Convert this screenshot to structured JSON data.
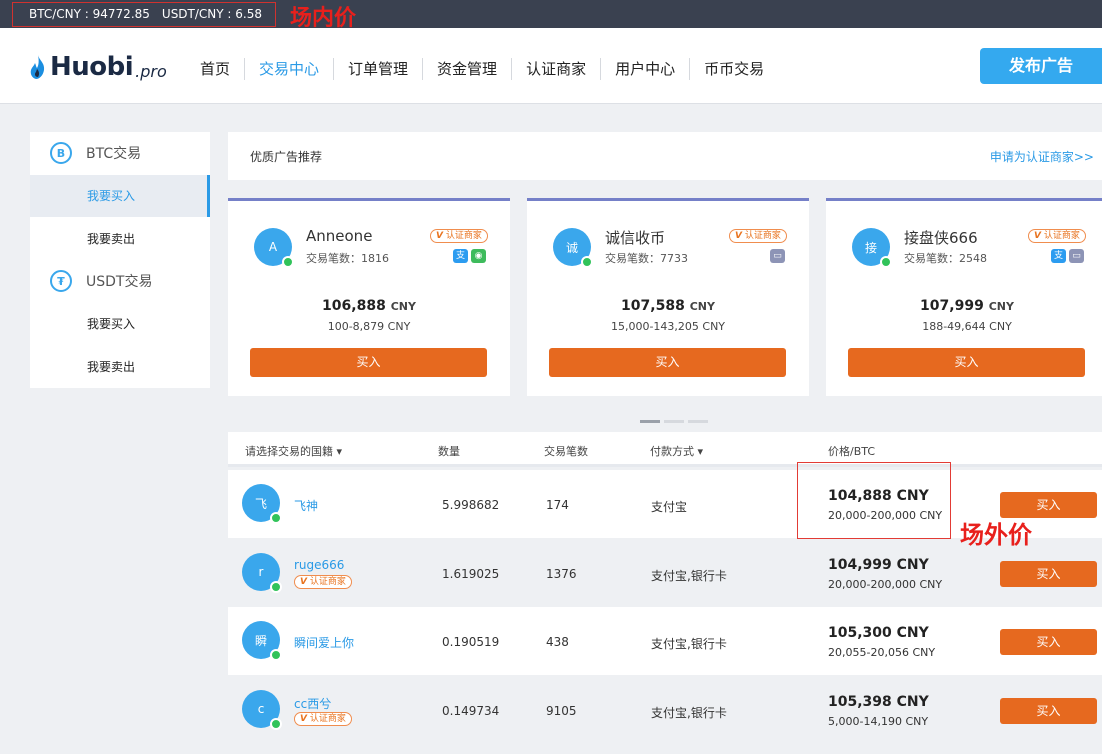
{
  "ticker": {
    "btc_cny": "BTC/CNY : 94772.85",
    "usdt_cny": "USDT/CNY : 6.58"
  },
  "annotations": {
    "inner_price": "场内价",
    "outer_price": "场外价"
  },
  "header": {
    "logo_text": "Huobi",
    "logo_suffix": ".pro",
    "nav": [
      "首页",
      "交易中心",
      "订单管理",
      "资金管理",
      "认证商家",
      "用户中心",
      "币币交易"
    ],
    "active_nav": "交易中心",
    "publish_label": "发布广告"
  },
  "sidebar": {
    "btc_section": {
      "icon": "B",
      "label": "BTC交易"
    },
    "btc_items": [
      "我要买入",
      "我要卖出"
    ],
    "usdt_section": {
      "icon": "₮",
      "label": "USDT交易"
    },
    "usdt_items": [
      "我要买入",
      "我要卖出"
    ]
  },
  "recommend": {
    "title": "优质广告推荐",
    "apply_link": "申请为认证商家>>"
  },
  "cards": [
    {
      "avatar": "A",
      "name": "Anneone",
      "trades": "交易笔数：1816",
      "badge": "认证商家",
      "payments": [
        "alipay",
        "wechat"
      ],
      "price": "106,888",
      "unit": "CNY",
      "range": "100-8,879 CNY",
      "buy": "买入"
    },
    {
      "avatar": "诚",
      "name": "诚信收币",
      "trades": "交易笔数：7733",
      "badge": "认证商家",
      "payments": [
        "bank"
      ],
      "price": "107,588",
      "unit": "CNY",
      "range": "15,000-143,205 CNY",
      "buy": "买入"
    },
    {
      "avatar": "接",
      "name": "接盘侠666",
      "trades": "交易笔数：2548",
      "badge": "认证商家",
      "payments": [
        "alipay",
        "bank"
      ],
      "price": "107,999",
      "unit": "CNY",
      "range": "188-49,644 CNY",
      "buy": "买入"
    }
  ],
  "table": {
    "headers": {
      "country": "请选择交易的国籍",
      "amount": "数量",
      "trades": "交易笔数",
      "payment": "付款方式",
      "price": "价格/BTC"
    },
    "rows": [
      {
        "avatar": "飞",
        "name": "飞神",
        "badge": "",
        "amount": "5.998682",
        "trades": "174",
        "payment": "支付宝",
        "price": "104,888 CNY",
        "range": "20,000-200,000 CNY",
        "buy": "买入"
      },
      {
        "avatar": "r",
        "name": "ruge666",
        "badge": "认证商家",
        "amount": "1.619025",
        "trades": "1376",
        "payment": "支付宝,银行卡",
        "price": "104,999 CNY",
        "range": "20,000-200,000 CNY",
        "buy": "买入"
      },
      {
        "avatar": "瞬",
        "name": "瞬间爱上你",
        "badge": "",
        "amount": "0.190519",
        "trades": "438",
        "payment": "支付宝,银行卡",
        "price": "105,300 CNY",
        "range": "20,055-20,056 CNY",
        "buy": "买入"
      },
      {
        "avatar": "c",
        "name": "cc西兮",
        "badge": "认证商家",
        "amount": "0.149734",
        "trades": "9105",
        "payment": "支付宝,银行卡",
        "price": "105,398 CNY",
        "range": "5,000-14,190 CNY",
        "buy": "买入"
      }
    ]
  },
  "colors": {
    "accent": "#2a9ae6",
    "buy": "#e6691f",
    "online": "#31c35a",
    "annotation": "#e8201c"
  }
}
